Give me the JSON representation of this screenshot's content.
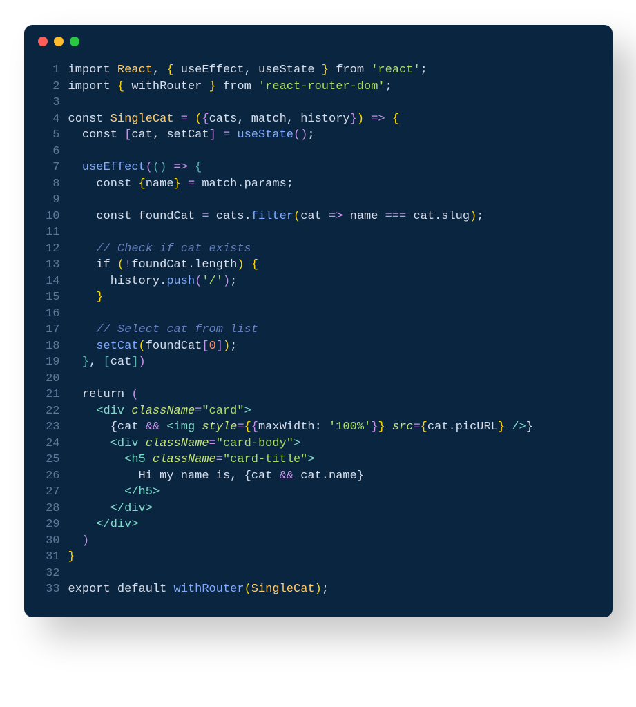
{
  "window": {
    "dots": {
      "red": "#ff5f57",
      "yellow": "#febc2e",
      "green": "#28c840"
    },
    "bg": "#0a2540"
  },
  "gutter_start": 1,
  "code_lines": [
    [
      [
        "kw",
        "import"
      ],
      [
        "punc",
        " "
      ],
      [
        "type",
        "React"
      ],
      [
        "punc",
        ", "
      ],
      [
        "brkt",
        "{"
      ],
      [
        "punc",
        " "
      ],
      [
        "id",
        "useEffect"
      ],
      [
        "punc",
        ", "
      ],
      [
        "id",
        "useState"
      ],
      [
        "punc",
        " "
      ],
      [
        "brkt",
        "}"
      ],
      [
        "punc",
        " "
      ],
      [
        "kw",
        "from"
      ],
      [
        "punc",
        " "
      ],
      [
        "str",
        "'react'"
      ],
      [
        "punc",
        ";"
      ]
    ],
    [
      [
        "kw",
        "import"
      ],
      [
        "punc",
        " "
      ],
      [
        "brkt",
        "{"
      ],
      [
        "punc",
        " "
      ],
      [
        "id",
        "withRouter"
      ],
      [
        "punc",
        " "
      ],
      [
        "brkt",
        "}"
      ],
      [
        "punc",
        " "
      ],
      [
        "kw",
        "from"
      ],
      [
        "punc",
        " "
      ],
      [
        "str",
        "'react-router-dom'"
      ],
      [
        "punc",
        ";"
      ]
    ],
    [],
    [
      [
        "kw",
        "const"
      ],
      [
        "punc",
        " "
      ],
      [
        "type",
        "SingleCat"
      ],
      [
        "punc",
        " "
      ],
      [
        "op",
        "="
      ],
      [
        "punc",
        " "
      ],
      [
        "brkt",
        "("
      ],
      [
        "brkt2",
        "{"
      ],
      [
        "id",
        "cats"
      ],
      [
        "punc",
        ", "
      ],
      [
        "id",
        "match"
      ],
      [
        "punc",
        ", "
      ],
      [
        "id",
        "history"
      ],
      [
        "brkt2",
        "}"
      ],
      [
        "brkt",
        ")"
      ],
      [
        "punc",
        " "
      ],
      [
        "op",
        "=>"
      ],
      [
        "punc",
        " "
      ],
      [
        "brkt",
        "{"
      ]
    ],
    [
      [
        "punc",
        "  "
      ],
      [
        "kw",
        "const"
      ],
      [
        "punc",
        " "
      ],
      [
        "brkt2",
        "["
      ],
      [
        "id",
        "cat"
      ],
      [
        "punc",
        ", "
      ],
      [
        "id",
        "setCat"
      ],
      [
        "brkt2",
        "]"
      ],
      [
        "punc",
        " "
      ],
      [
        "op",
        "="
      ],
      [
        "punc",
        " "
      ],
      [
        "fn",
        "useState"
      ],
      [
        "brkt2",
        "("
      ],
      [
        "brkt2",
        ")"
      ],
      [
        "punc",
        ";"
      ]
    ],
    [],
    [
      [
        "punc",
        "  "
      ],
      [
        "fn",
        "useEffect"
      ],
      [
        "brkt2",
        "("
      ],
      [
        "brkt3",
        "("
      ],
      [
        "brkt3",
        ")"
      ],
      [
        "punc",
        " "
      ],
      [
        "op",
        "=>"
      ],
      [
        "punc",
        " "
      ],
      [
        "brkt3",
        "{"
      ]
    ],
    [
      [
        "punc",
        "    "
      ],
      [
        "kw",
        "const"
      ],
      [
        "punc",
        " "
      ],
      [
        "brkt",
        "{"
      ],
      [
        "id",
        "name"
      ],
      [
        "brkt",
        "}"
      ],
      [
        "punc",
        " "
      ],
      [
        "op",
        "="
      ],
      [
        "punc",
        " "
      ],
      [
        "id",
        "match"
      ],
      [
        "punc",
        "."
      ],
      [
        "id",
        "params"
      ],
      [
        "punc",
        ";"
      ]
    ],
    [],
    [
      [
        "punc",
        "    "
      ],
      [
        "kw",
        "const"
      ],
      [
        "punc",
        " "
      ],
      [
        "id",
        "foundCat"
      ],
      [
        "punc",
        " "
      ],
      [
        "op",
        "="
      ],
      [
        "punc",
        " "
      ],
      [
        "id",
        "cats"
      ],
      [
        "punc",
        "."
      ],
      [
        "fn",
        "filter"
      ],
      [
        "brkt",
        "("
      ],
      [
        "id",
        "cat"
      ],
      [
        "punc",
        " "
      ],
      [
        "op",
        "=>"
      ],
      [
        "punc",
        " "
      ],
      [
        "id",
        "name"
      ],
      [
        "punc",
        " "
      ],
      [
        "op",
        "==="
      ],
      [
        "punc",
        " "
      ],
      [
        "id",
        "cat"
      ],
      [
        "punc",
        "."
      ],
      [
        "id",
        "slug"
      ],
      [
        "brkt",
        ")"
      ],
      [
        "punc",
        ";"
      ]
    ],
    [],
    [
      [
        "punc",
        "    "
      ],
      [
        "com",
        "// Check if cat exists"
      ]
    ],
    [
      [
        "punc",
        "    "
      ],
      [
        "kw",
        "if"
      ],
      [
        "punc",
        " "
      ],
      [
        "brkt",
        "("
      ],
      [
        "op",
        "!"
      ],
      [
        "id",
        "foundCat"
      ],
      [
        "punc",
        "."
      ],
      [
        "id",
        "length"
      ],
      [
        "brkt",
        ")"
      ],
      [
        "punc",
        " "
      ],
      [
        "brkt",
        "{"
      ]
    ],
    [
      [
        "punc",
        "      "
      ],
      [
        "id",
        "history"
      ],
      [
        "punc",
        "."
      ],
      [
        "fn",
        "push"
      ],
      [
        "brkt2",
        "("
      ],
      [
        "str",
        "'/'"
      ],
      [
        "brkt2",
        ")"
      ],
      [
        "punc",
        ";"
      ]
    ],
    [
      [
        "punc",
        "    "
      ],
      [
        "brkt",
        "}"
      ]
    ],
    [],
    [
      [
        "punc",
        "    "
      ],
      [
        "com",
        "// Select cat from list"
      ]
    ],
    [
      [
        "punc",
        "    "
      ],
      [
        "fn",
        "setCat"
      ],
      [
        "brkt",
        "("
      ],
      [
        "id",
        "foundCat"
      ],
      [
        "brkt2",
        "["
      ],
      [
        "num",
        "0"
      ],
      [
        "brkt2",
        "]"
      ],
      [
        "brkt",
        ")"
      ],
      [
        "punc",
        ";"
      ]
    ],
    [
      [
        "punc",
        "  "
      ],
      [
        "brkt3",
        "}"
      ],
      [
        "punc",
        ", "
      ],
      [
        "brkt3",
        "["
      ],
      [
        "id",
        "cat"
      ],
      [
        "brkt3",
        "]"
      ],
      [
        "brkt2",
        ")"
      ]
    ],
    [],
    [
      [
        "punc",
        "  "
      ],
      [
        "kw",
        "return"
      ],
      [
        "punc",
        " "
      ],
      [
        "brkt2",
        "("
      ]
    ],
    [
      [
        "punc",
        "    "
      ],
      [
        "angle",
        "<"
      ],
      [
        "tag",
        "div"
      ],
      [
        "punc",
        " "
      ],
      [
        "attr",
        "className"
      ],
      [
        "eq",
        "="
      ],
      [
        "str",
        "\"card\""
      ],
      [
        "angle",
        ">"
      ]
    ],
    [
      [
        "punc",
        "      "
      ],
      [
        "jsxbr",
        "{"
      ],
      [
        "id",
        "cat"
      ],
      [
        "punc",
        " "
      ],
      [
        "op",
        "&&"
      ],
      [
        "punc",
        " "
      ],
      [
        "angle",
        "<"
      ],
      [
        "tag",
        "img"
      ],
      [
        "punc",
        " "
      ],
      [
        "attr",
        "style"
      ],
      [
        "eq",
        "="
      ],
      [
        "brkt",
        "{"
      ],
      [
        "brkt2",
        "{"
      ],
      [
        "id",
        "maxWidth"
      ],
      [
        "punc",
        ": "
      ],
      [
        "str",
        "'100%'"
      ],
      [
        "brkt2",
        "}"
      ],
      [
        "brkt",
        "}"
      ],
      [
        "punc",
        " "
      ],
      [
        "attr",
        "src"
      ],
      [
        "eq",
        "="
      ],
      [
        "brkt",
        "{"
      ],
      [
        "id",
        "cat"
      ],
      [
        "punc",
        "."
      ],
      [
        "id",
        "picURL"
      ],
      [
        "brkt",
        "}"
      ],
      [
        "punc",
        " "
      ],
      [
        "angle",
        "/>"
      ],
      [
        "jsxbr",
        "}"
      ]
    ],
    [
      [
        "punc",
        "      "
      ],
      [
        "angle",
        "<"
      ],
      [
        "tag",
        "div"
      ],
      [
        "punc",
        " "
      ],
      [
        "attr",
        "className"
      ],
      [
        "eq",
        "="
      ],
      [
        "str",
        "\"card-body\""
      ],
      [
        "angle",
        ">"
      ]
    ],
    [
      [
        "punc",
        "        "
      ],
      [
        "angle",
        "<"
      ],
      [
        "tag",
        "h5"
      ],
      [
        "punc",
        " "
      ],
      [
        "attr",
        "className"
      ],
      [
        "eq",
        "="
      ],
      [
        "str",
        "\"card-title\""
      ],
      [
        "angle",
        ">"
      ]
    ],
    [
      [
        "punc",
        "          "
      ],
      [
        "id",
        "Hi my name is, "
      ],
      [
        "jsxbr",
        "{"
      ],
      [
        "id",
        "cat"
      ],
      [
        "punc",
        " "
      ],
      [
        "op",
        "&&"
      ],
      [
        "punc",
        " "
      ],
      [
        "id",
        "cat"
      ],
      [
        "punc",
        "."
      ],
      [
        "id",
        "name"
      ],
      [
        "jsxbr",
        "}"
      ]
    ],
    [
      [
        "punc",
        "        "
      ],
      [
        "angle",
        "</"
      ],
      [
        "tag",
        "h5"
      ],
      [
        "angle",
        ">"
      ]
    ],
    [
      [
        "punc",
        "      "
      ],
      [
        "angle",
        "</"
      ],
      [
        "tag",
        "div"
      ],
      [
        "angle",
        ">"
      ]
    ],
    [
      [
        "punc",
        "    "
      ],
      [
        "angle",
        "</"
      ],
      [
        "tag",
        "div"
      ],
      [
        "angle",
        ">"
      ]
    ],
    [
      [
        "punc",
        "  "
      ],
      [
        "brkt2",
        ")"
      ]
    ],
    [
      [
        "brkt",
        "}"
      ]
    ],
    [],
    [
      [
        "kw",
        "export"
      ],
      [
        "punc",
        " "
      ],
      [
        "kw",
        "default"
      ],
      [
        "punc",
        " "
      ],
      [
        "fn",
        "withRouter"
      ],
      [
        "brkt",
        "("
      ],
      [
        "type",
        "SingleCat"
      ],
      [
        "brkt",
        ")"
      ],
      [
        "punc",
        ";"
      ]
    ]
  ]
}
